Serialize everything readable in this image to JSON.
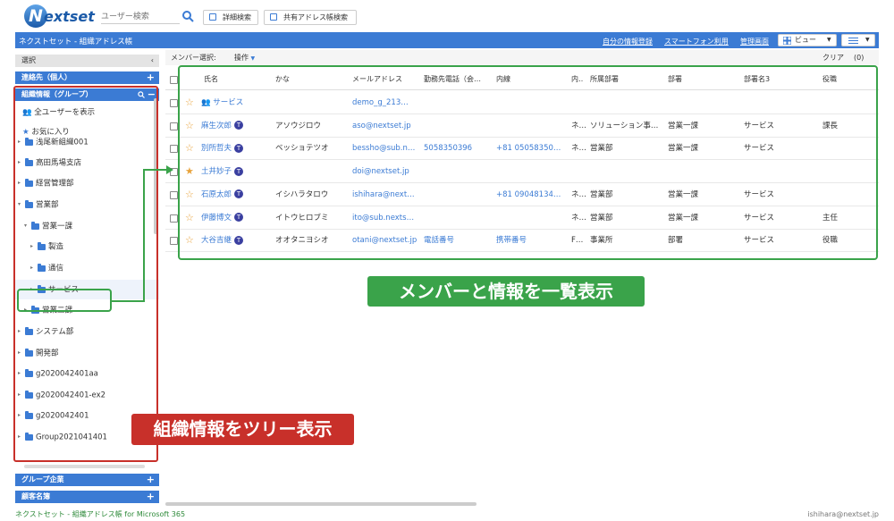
{
  "header": {
    "logo_mark": "N",
    "logo_text": "extset",
    "search_placeholder": "ユーザー検索",
    "detail_search_label": "詳細検索",
    "shared_search_label": "共有アドレス帳検索"
  },
  "titlebar": {
    "title": "ネクストセット - 組織アドレス帳",
    "my_info": "自分の情報登録",
    "smartphone": "スマートフォン利用",
    "admin": "管理画面",
    "view_label": "ビュー"
  },
  "sidebar": {
    "select_label": "選択",
    "contacts_label": "連絡先（個人）",
    "org_label": "組織情報（グループ）",
    "show_all": "全ユーザーを表示",
    "favorites": "お気に入り",
    "tree": [
      {
        "label": "浅尾新組織001"
      },
      {
        "label": "高田馬場支店"
      },
      {
        "label": "経営管理部"
      },
      {
        "label": "営業部"
      },
      {
        "label": "営業一課"
      },
      {
        "label": "製造"
      },
      {
        "label": "通信"
      },
      {
        "label": "サービス"
      },
      {
        "label": "営業二課"
      },
      {
        "label": "システム部"
      },
      {
        "label": "開発部"
      },
      {
        "label": "g2020042401aa"
      },
      {
        "label": "g2020042401-ex2"
      },
      {
        "label": "g2020042401"
      },
      {
        "label": "Group2021041401"
      }
    ],
    "group_companies": "グループ企業",
    "customers": "顧客名簿"
  },
  "main": {
    "member_select": "メンバー選択:",
    "operation": "操作",
    "clear": "クリア",
    "count": "(0)",
    "columns": [
      "氏名",
      "かな",
      "メールアドレス",
      "勤務先電話（会…",
      "内線",
      "内…",
      "所属部署",
      "部署",
      "部署名3",
      "役職"
    ],
    "rows": [
      {
        "name": "サービス",
        "kana": "",
        "email": "demo_g_213…",
        "work_phone": "",
        "ext": "",
        "ext2": "",
        "dept_affil": "",
        "dept": "",
        "dept3": "",
        "title": "",
        "starred": false,
        "group": true
      },
      {
        "name": "麻生次郎",
        "kana": "アソウジロウ",
        "email": "aso@nextset.jp",
        "work_phone": "",
        "ext": "",
        "ext2": "ネ…",
        "dept_affil": "ソリューション事…",
        "dept": "営業一課",
        "dept3": "サービス",
        "title": "課長",
        "starred": false,
        "group": false
      },
      {
        "name": "別所哲夫",
        "kana": "ベッショテツオ",
        "email": "bessho@sub.n…",
        "work_phone": "5058350396",
        "ext": "+81 05058350…",
        "ext2": "ネ…",
        "dept_affil": "営業部",
        "dept": "営業一課",
        "dept3": "サービス",
        "title": "",
        "starred": false,
        "group": false
      },
      {
        "name": "土井妙子",
        "kana": "",
        "email": "doi@nextset.jp",
        "work_phone": "",
        "ext": "",
        "ext2": "",
        "dept_affil": "",
        "dept": "",
        "dept3": "",
        "title": "",
        "starred": true,
        "group": false
      },
      {
        "name": "石原太郎",
        "kana": "イシハラタロウ",
        "email": "ishihara@next…",
        "work_phone": "",
        "ext": "+81 09048134…",
        "ext2": "ネ…",
        "dept_affil": "営業部",
        "dept": "営業一課",
        "dept3": "サービス",
        "title": "",
        "starred": false,
        "group": false
      },
      {
        "name": "伊藤博文",
        "kana": "イトウヒロブミ",
        "email": "ito@sub.nexts…",
        "work_phone": "",
        "ext": "",
        "ext2": "ネ…",
        "dept_affil": "営業部",
        "dept": "営業一課",
        "dept3": "サービス",
        "title": "主任",
        "starred": false,
        "group": false
      },
      {
        "name": "大谷吉継",
        "kana": "オオタニヨシオ",
        "email": "otani@nextset.jp",
        "work_phone": "電話番号",
        "ext": "携帯番号",
        "ext2": "F…",
        "dept_affil": "事業所",
        "dept": "部署",
        "dept3": "サービス",
        "title": "役職",
        "starred": false,
        "group": false
      }
    ],
    "badge_letter": "T"
  },
  "callouts": {
    "members": "メンバーと情報を一覧表示",
    "tree": "組織情報をツリー表示"
  },
  "footer": {
    "left": "ネクストセット - 組織アドレス帳 for Microsoft 365",
    "right": "ishihara@nextset.jp"
  },
  "colors": {
    "accent": "#3b7bd4",
    "red": "#c8302a",
    "green": "#3aa34a",
    "star": "#e8a33c"
  }
}
